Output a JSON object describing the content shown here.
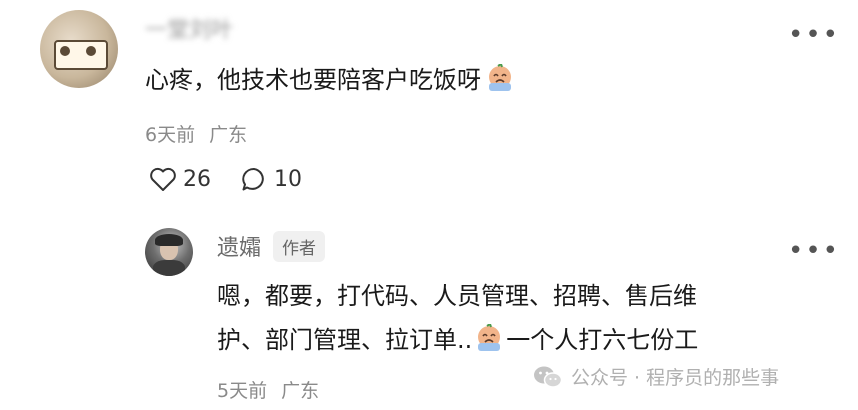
{
  "comment": {
    "author_name": "一堂刘叶",
    "text": "心疼，他技术也要陪客户吃饭呀",
    "emoji": "crying-emoji",
    "time": "6天前",
    "location": "广东",
    "likes": "26",
    "replies": "10",
    "more_label": "•••"
  },
  "reply": {
    "author_name": "遗孀",
    "badge": "作者",
    "text_line1": "嗯，都要，打代码、人员管理、招聘、售后维",
    "text_line2_a": "护、部门管理、拉订单..",
    "text_line2_b": "一个人打六七份工",
    "emoji": "crying-emoji",
    "time": "5天前",
    "location": "广东",
    "more_label": "•••"
  },
  "watermark": {
    "text": "公众号 · 程序员的那些事"
  },
  "colors": {
    "text": "#1a1a1a",
    "meta": "#8a8a8a",
    "badge_bg": "#f0f0f0",
    "emoji_face": "#f2b48a"
  }
}
